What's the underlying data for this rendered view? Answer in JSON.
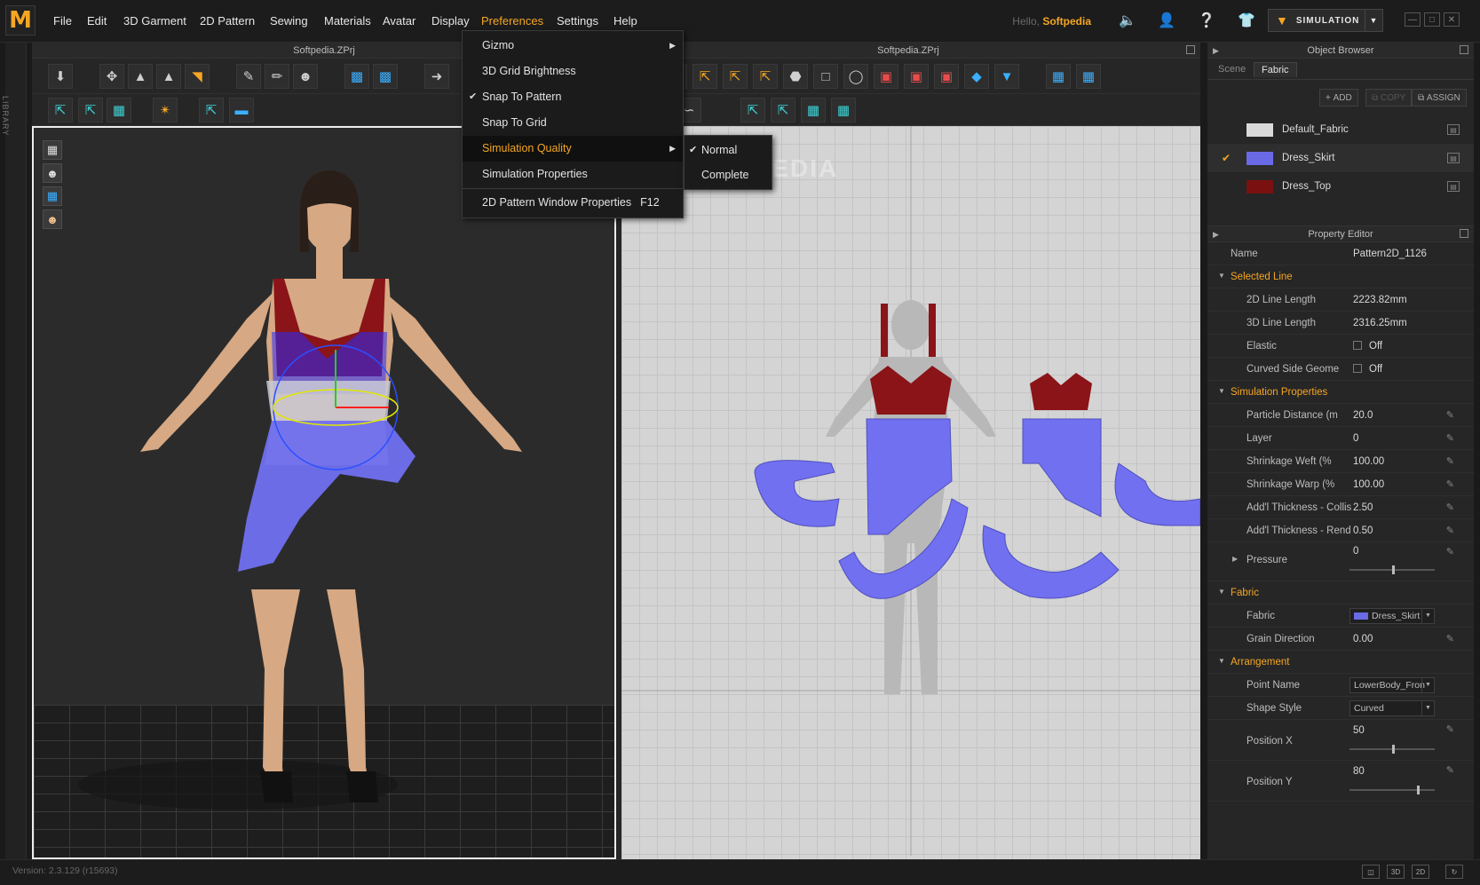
{
  "menubar": {
    "logo": "M",
    "items": [
      "File",
      "Edit",
      "3D Garment",
      "2D Pattern",
      "Sewing",
      "Materials",
      "Avatar",
      "Display",
      "Preferences",
      "Settings",
      "Help"
    ],
    "greeting": "Hello,",
    "username": "Softpedia",
    "simulation_label": "SIMULATION"
  },
  "library_label": "LIBRARY",
  "window3d": {
    "title": "Softpedia.ZPrj"
  },
  "window2d": {
    "title": "Softpedia.ZPrj",
    "watermark": "SOFTPEDIA"
  },
  "preferences_menu": {
    "items": [
      {
        "label": "Gizmo",
        "submenu": true,
        "checked": false
      },
      {
        "label": "3D Grid Brightness",
        "submenu": false,
        "checked": false
      },
      {
        "label": "Snap To Pattern",
        "submenu": false,
        "checked": true
      },
      {
        "label": "Snap To Grid",
        "submenu": false,
        "checked": false
      },
      {
        "label": "Simulation Quality",
        "submenu": true,
        "checked": false,
        "highlighted": true
      },
      {
        "label": "Simulation Properties",
        "submenu": false,
        "checked": false
      },
      {
        "label": "2D Pattern Window Properties",
        "shortcut": "F12",
        "submenu": false,
        "checked": false
      }
    ]
  },
  "quality_submenu": {
    "items": [
      {
        "label": "Normal",
        "checked": true
      },
      {
        "label": "Complete",
        "checked": false
      }
    ]
  },
  "object_browser": {
    "title": "Object Browser",
    "tabs": [
      "Scene",
      "Fabric"
    ],
    "active_tab": "Fabric",
    "actions": {
      "add": "ADD",
      "copy": "COPY",
      "assign": "ASSIGN"
    },
    "fabrics": [
      {
        "name": "Default_Fabric",
        "color": "#d9d9d9",
        "selected": false
      },
      {
        "name": "Dress_Skirt",
        "color": "#6a6ae6",
        "selected": true
      },
      {
        "name": "Dress_Top",
        "color": "#7a1010",
        "selected": false
      }
    ]
  },
  "property_editor": {
    "title": "Property Editor",
    "name_label": "Name",
    "name_value": "Pattern2D_1126",
    "selected_line": {
      "title": "Selected Line",
      "line_2d_label": "2D Line Length",
      "line_2d_value": "2223.82mm",
      "line_3d_label": "3D Line Length",
      "line_3d_value": "2316.25mm",
      "elastic_label": "Elastic",
      "elastic_value": "Off",
      "curved_label": "Curved Side Geome",
      "curved_value": "Off"
    },
    "simulation": {
      "title": "Simulation Properties",
      "particle_label": "Particle Distance (m",
      "particle_value": "20.0",
      "layer_label": "Layer",
      "layer_value": "0",
      "weft_label": "Shrinkage Weft (%",
      "weft_value": "100.00",
      "warp_label": "Shrinkage Warp (%",
      "warp_value": "100.00",
      "thick_col_label": "Add'l Thickness - Collisio",
      "thick_col_value": "2.50",
      "thick_ren_label": "Add'l Thickness - Renderi",
      "thick_ren_value": "0.50",
      "pressure_label": "Pressure",
      "pressure_value": "0"
    },
    "fabric": {
      "title": "Fabric",
      "fabric_label": "Fabric",
      "fabric_value": "Dress_Skirt",
      "grain_label": "Grain Direction",
      "grain_value": "0.00"
    },
    "arrangement": {
      "title": "Arrangement",
      "point_label": "Point Name",
      "point_value": "LowerBody_Fron",
      "shape_label": "Shape Style",
      "shape_value": "Curved",
      "posx_label": "Position X",
      "posx_value": "50",
      "posy_label": "Position Y",
      "posy_value": "80"
    }
  },
  "status": {
    "version": "Version: 2.3.129    (r15693)"
  }
}
